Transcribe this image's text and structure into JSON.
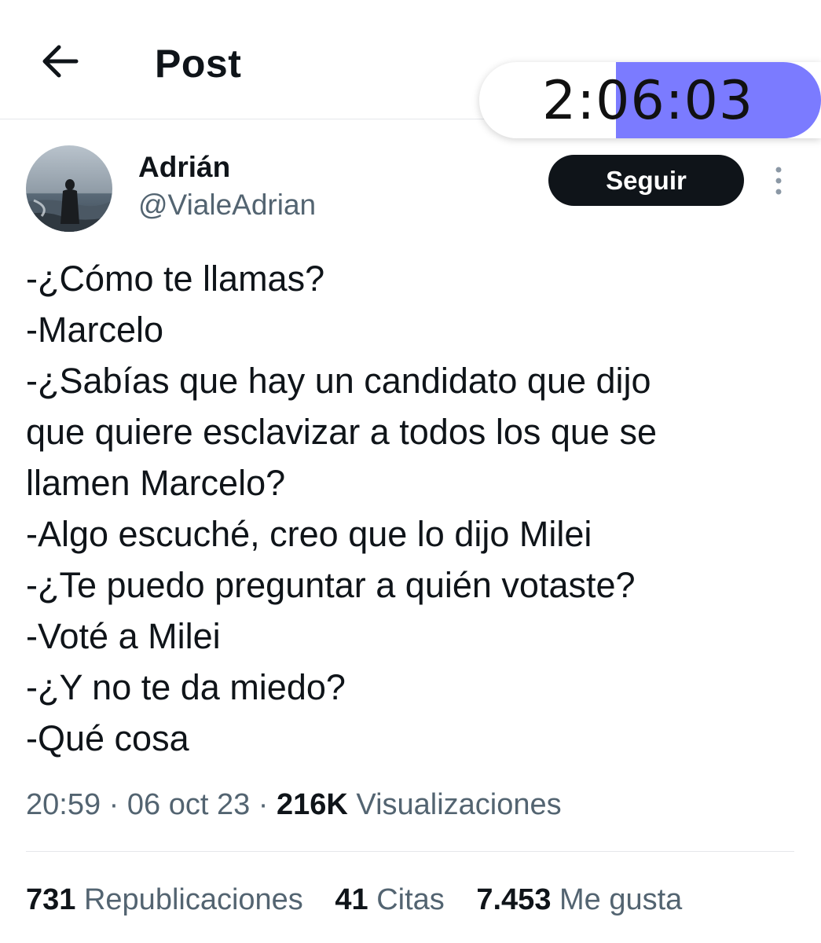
{
  "header": {
    "title": "Post",
    "back_icon": "arrow-left-icon"
  },
  "timer": {
    "display": "2:06:03",
    "fill_fraction": 0.6,
    "fill_color": "#7b7bff"
  },
  "author": {
    "name": "Adrián",
    "handle": "@VialeAdrian",
    "follow_label": "Seguir",
    "more_icon": "more-vertical-icon"
  },
  "tweet": {
    "lines": [
      "-¿Cómo te llamas?",
      "-Marcelo",
      "-¿Sabías que hay un candidato que dijo",
      "que quiere esclavizar a todos los que se",
      "llamen Marcelo?",
      "-Algo escuché, creo que lo dijo Milei",
      "-¿Te puedo preguntar a quién votaste?",
      "-Voté a Milei",
      "-¿Y no te da miedo?",
      "-Qué cosa"
    ]
  },
  "meta": {
    "time": "20:59",
    "date": "06 oct 23",
    "separator": "·",
    "views_count": "216K",
    "views_label": "Visualizaciones"
  },
  "stats": {
    "reposts_count": "731",
    "reposts_label": "Republicaciones",
    "quotes_count": "41",
    "quotes_label": "Citas",
    "likes_count": "7.453",
    "likes_label": "Me gusta"
  },
  "colors": {
    "text": "#0f1419",
    "secondary": "#536471",
    "divider": "#e5e7eb",
    "button": "#0f1419"
  }
}
